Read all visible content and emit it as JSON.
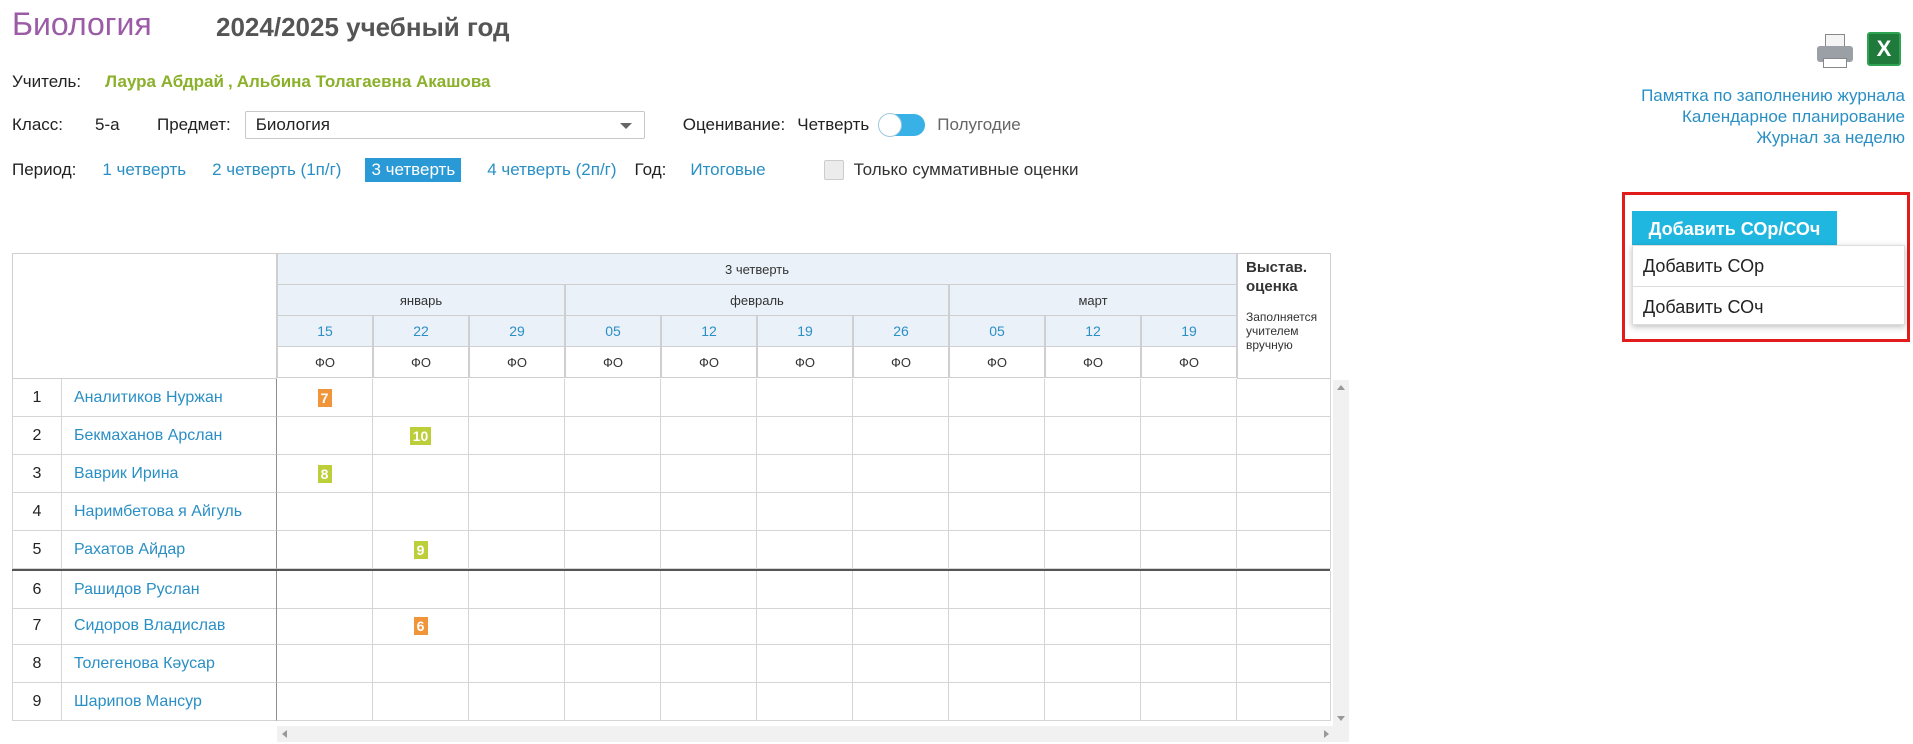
{
  "header": {
    "subject_title": "Биология",
    "school_year": "2024/2025 учебный год"
  },
  "teacher": {
    "label": "Учитель:",
    "names": [
      "Лаура Абдрай",
      "Альбина Толагаевна Акашова"
    ],
    "separator": ","
  },
  "class_row": {
    "class_label": "Класс:",
    "class_value": "5-а",
    "subject_label": "Предмет:",
    "subject_selected": "Биология",
    "assessment_label": "Оценивание:",
    "assessment_left": "Четверть",
    "assessment_right": "Полугодие",
    "toggle_state": "Четверть"
  },
  "period_row": {
    "label": "Период:",
    "periods": [
      "1 четверть",
      "2 четверть (1п/г)",
      "3 четверть",
      "4 четверть (2п/г)"
    ],
    "active_period": "3 четверть",
    "year_label": "Год:",
    "year_link": "Итоговые",
    "summative_only_label": "Только суммативные оценки",
    "summative_only_checked": false
  },
  "right_links": [
    "Памятка по заполнению журнала",
    "Календарное планирование",
    "Журнал за неделю"
  ],
  "icons": [
    "printer-icon",
    "excel-icon"
  ],
  "add_button": {
    "label": "Добавить СОр/СОч",
    "color": "#1fb7e0",
    "menu": [
      "Добавить СОр",
      "Добавить СОч"
    ]
  },
  "journal": {
    "quarter_label": "3 четверть",
    "months": [
      {
        "name": "январь",
        "dates": [
          "15",
          "22",
          "29"
        ]
      },
      {
        "name": "февраль",
        "dates": [
          "05",
          "12",
          "19",
          "26"
        ]
      },
      {
        "name": "март",
        "dates": [
          "05",
          "12",
          "19"
        ]
      }
    ],
    "column_type": "ФО",
    "final_column": {
      "title": "Выстав. оценка",
      "note": "Заполняется учителем вручную"
    },
    "students": [
      {
        "num": "1",
        "name": "Аналитиков Нуржан",
        "grades": {
          "0": "7"
        }
      },
      {
        "num": "2",
        "name": "Бекмаханов Арслан",
        "grades": {
          "1": "10"
        }
      },
      {
        "num": "3",
        "name": "Ваврик Ирина",
        "grades": {
          "0": "8"
        }
      },
      {
        "num": "4",
        "name": "Наримбетова я Айгуль",
        "grades": {}
      },
      {
        "num": "5",
        "name": "Рахатов Айдар",
        "grades": {
          "1": "9"
        }
      },
      {
        "num": "6",
        "name": "Рашидов Руслан",
        "grades": {}
      },
      {
        "num": "7",
        "name": "Сидоров Владислав",
        "grades": {
          "1": "6"
        }
      },
      {
        "num": "8",
        "name": "Толегенова Кəусар",
        "grades": {}
      },
      {
        "num": "9",
        "name": "Шарипов Мансур",
        "grades": {}
      }
    ],
    "grade_colors": {
      "6": "#f0953a",
      "7": "#f0953a",
      "8": "#bccf3a",
      "9": "#bccf3a",
      "10": "#bccf3a"
    }
  },
  "colors": {
    "accent": "#2a8fc4",
    "title": "#9b5ba6",
    "teacher": "#8bb02a",
    "highlight_border": "#e21b1b"
  }
}
